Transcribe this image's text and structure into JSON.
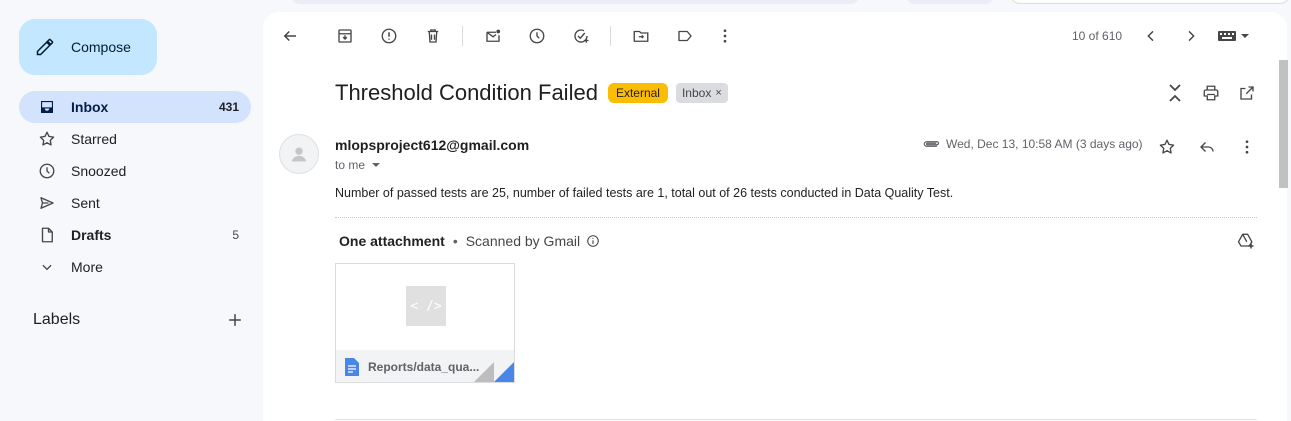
{
  "sidebar": {
    "compose_label": "Compose",
    "items": [
      {
        "label": "Inbox",
        "count": "431"
      },
      {
        "label": "Starred",
        "count": ""
      },
      {
        "label": "Snoozed",
        "count": ""
      },
      {
        "label": "Sent",
        "count": ""
      },
      {
        "label": "Drafts",
        "count": "5"
      },
      {
        "label": "More",
        "count": ""
      }
    ],
    "labels_heading": "Labels"
  },
  "toolbar": {
    "pager": "10 of 610",
    "icons": [
      "back-arrow-icon",
      "archive-icon",
      "report-spam-icon",
      "delete-icon",
      "mark-unread-icon",
      "snooze-icon",
      "add-to-tasks-icon",
      "move-to-icon",
      "label-icon",
      "more-vert-icon",
      "newer-icon",
      "older-icon",
      "keyboard-icon"
    ]
  },
  "message": {
    "subject": "Threshold Condition Failed",
    "badge_external": "External",
    "badge_inbox": "Inbox",
    "badge_close": "×",
    "sender": "mlopsproject612@gmail.com",
    "to": "to me",
    "date": "Wed, Dec 13, 10:58 AM (3 days ago)",
    "body": "Number of passed tests are 25, number of failed tests are 1, total out of 26 tests conducted in Data Quality Test."
  },
  "attachments": {
    "heading": "One attachment",
    "separator": "•",
    "scanned": "Scanned by Gmail",
    "file_name": "Reports/data_qua...",
    "thumb_glyph": "< />"
  },
  "colors": {
    "compose_bg": "#c2e7ff",
    "active_nav": "#d3e3fd",
    "external_badge": "#fbbc04",
    "doc_blue": "#4a86e8"
  }
}
